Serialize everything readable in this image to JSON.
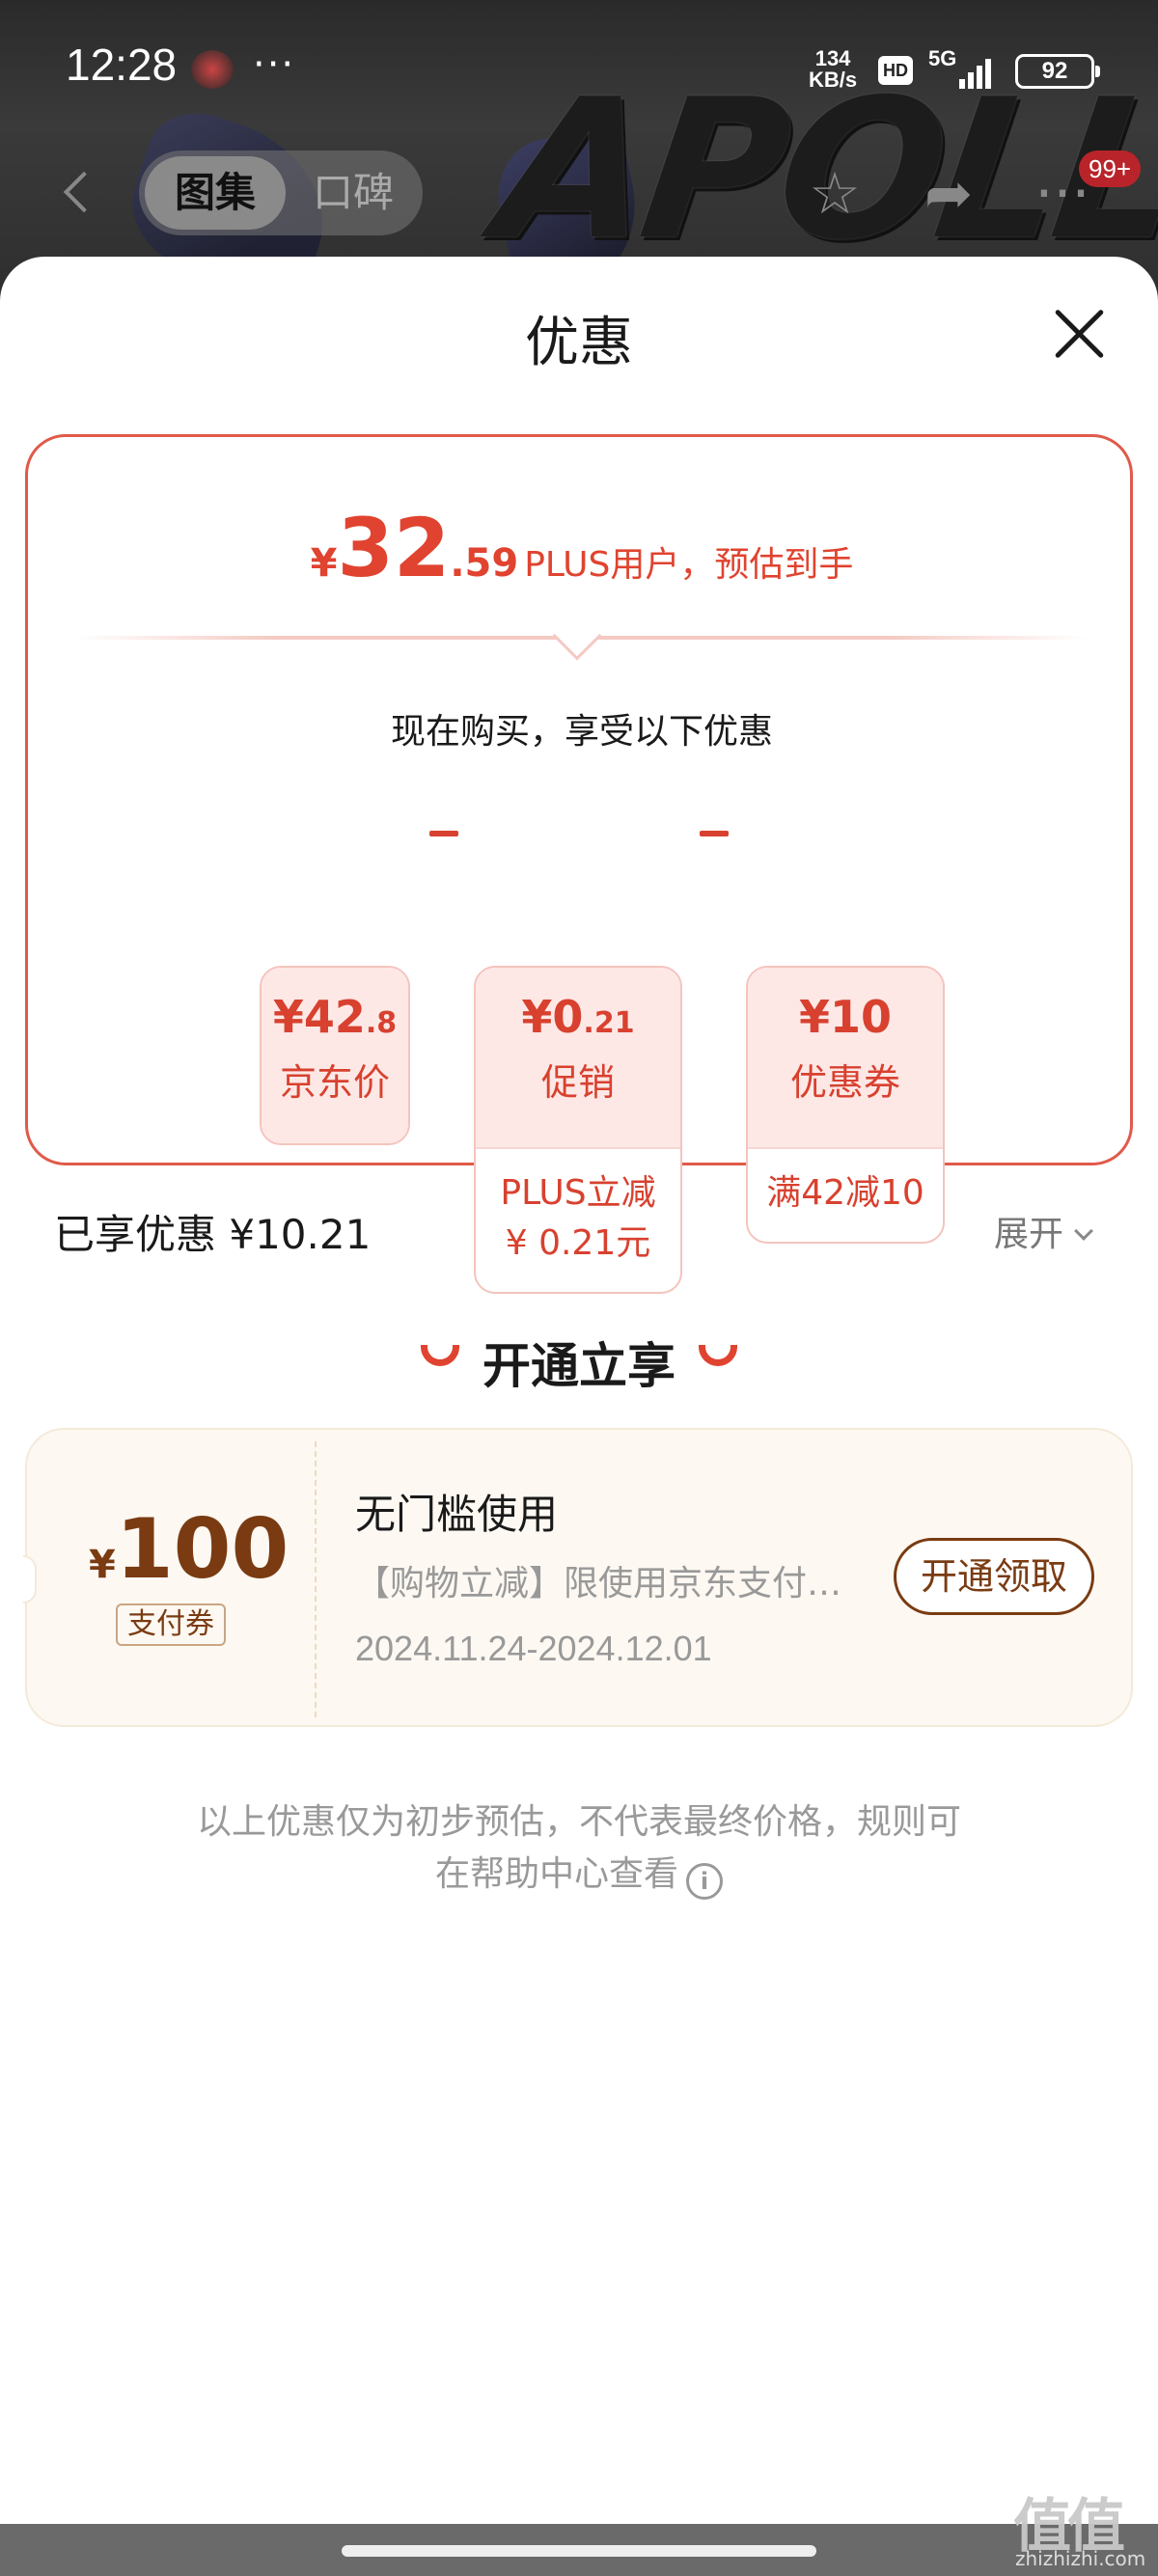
{
  "status_bar": {
    "time": "12:28",
    "more": "···",
    "speed_value": "134",
    "speed_unit": "KB/s",
    "hd": "HD",
    "network": "5G",
    "battery": "92"
  },
  "product_banner": {
    "brand_text": "APOLLO"
  },
  "nav": {
    "tabs": [
      {
        "label": "图集",
        "active": true
      },
      {
        "label": "口碑",
        "active": false
      }
    ],
    "cart_badge": "99+"
  },
  "sheet": {
    "title": "优惠",
    "price_summary": {
      "currency": "¥",
      "integer": "32",
      "decimal": ".59",
      "suffix": "PLUS用户，预估到手"
    },
    "buy_note": "现在购买，享受以下优惠",
    "breakdown": [
      {
        "amount_int": "¥42",
        "amount_dec": ".8",
        "label": "京东价",
        "detail": ""
      },
      {
        "amount_int": "¥0",
        "amount_dec": ".21",
        "label": "促销",
        "detail_line1": "PLUS立减",
        "detail_line2": "¥ 0.21元"
      },
      {
        "amount_int": "¥10",
        "amount_dec": "",
        "label": "优惠券",
        "detail_line1": "满42减10",
        "detail_line2": ""
      }
    ],
    "enjoyed": "已享优惠 ¥10.21",
    "expand_label": "展开",
    "open_section_title": "开通立享",
    "coupon": {
      "currency": "¥",
      "amount": "100",
      "tag": "支付券",
      "title": "无门槛使用",
      "description": "【购物立减】限使用京东支付时使用",
      "date_range": "2024.11.24-2024.12.01",
      "button": "开通领取"
    },
    "disclaimer_line1": "以上优惠仅为初步预估，不代表最终价格，规则可",
    "disclaimer_line2": "在帮助中心查看"
  },
  "watermark": {
    "logo": "值值值",
    "url": "zhizhizhi.com"
  },
  "colors": {
    "accent_red": "#e0432f",
    "coupon_brown": "#7a3b12",
    "chip_bg": "#fde8e6",
    "coupon_bg": "#fdf8f2"
  }
}
